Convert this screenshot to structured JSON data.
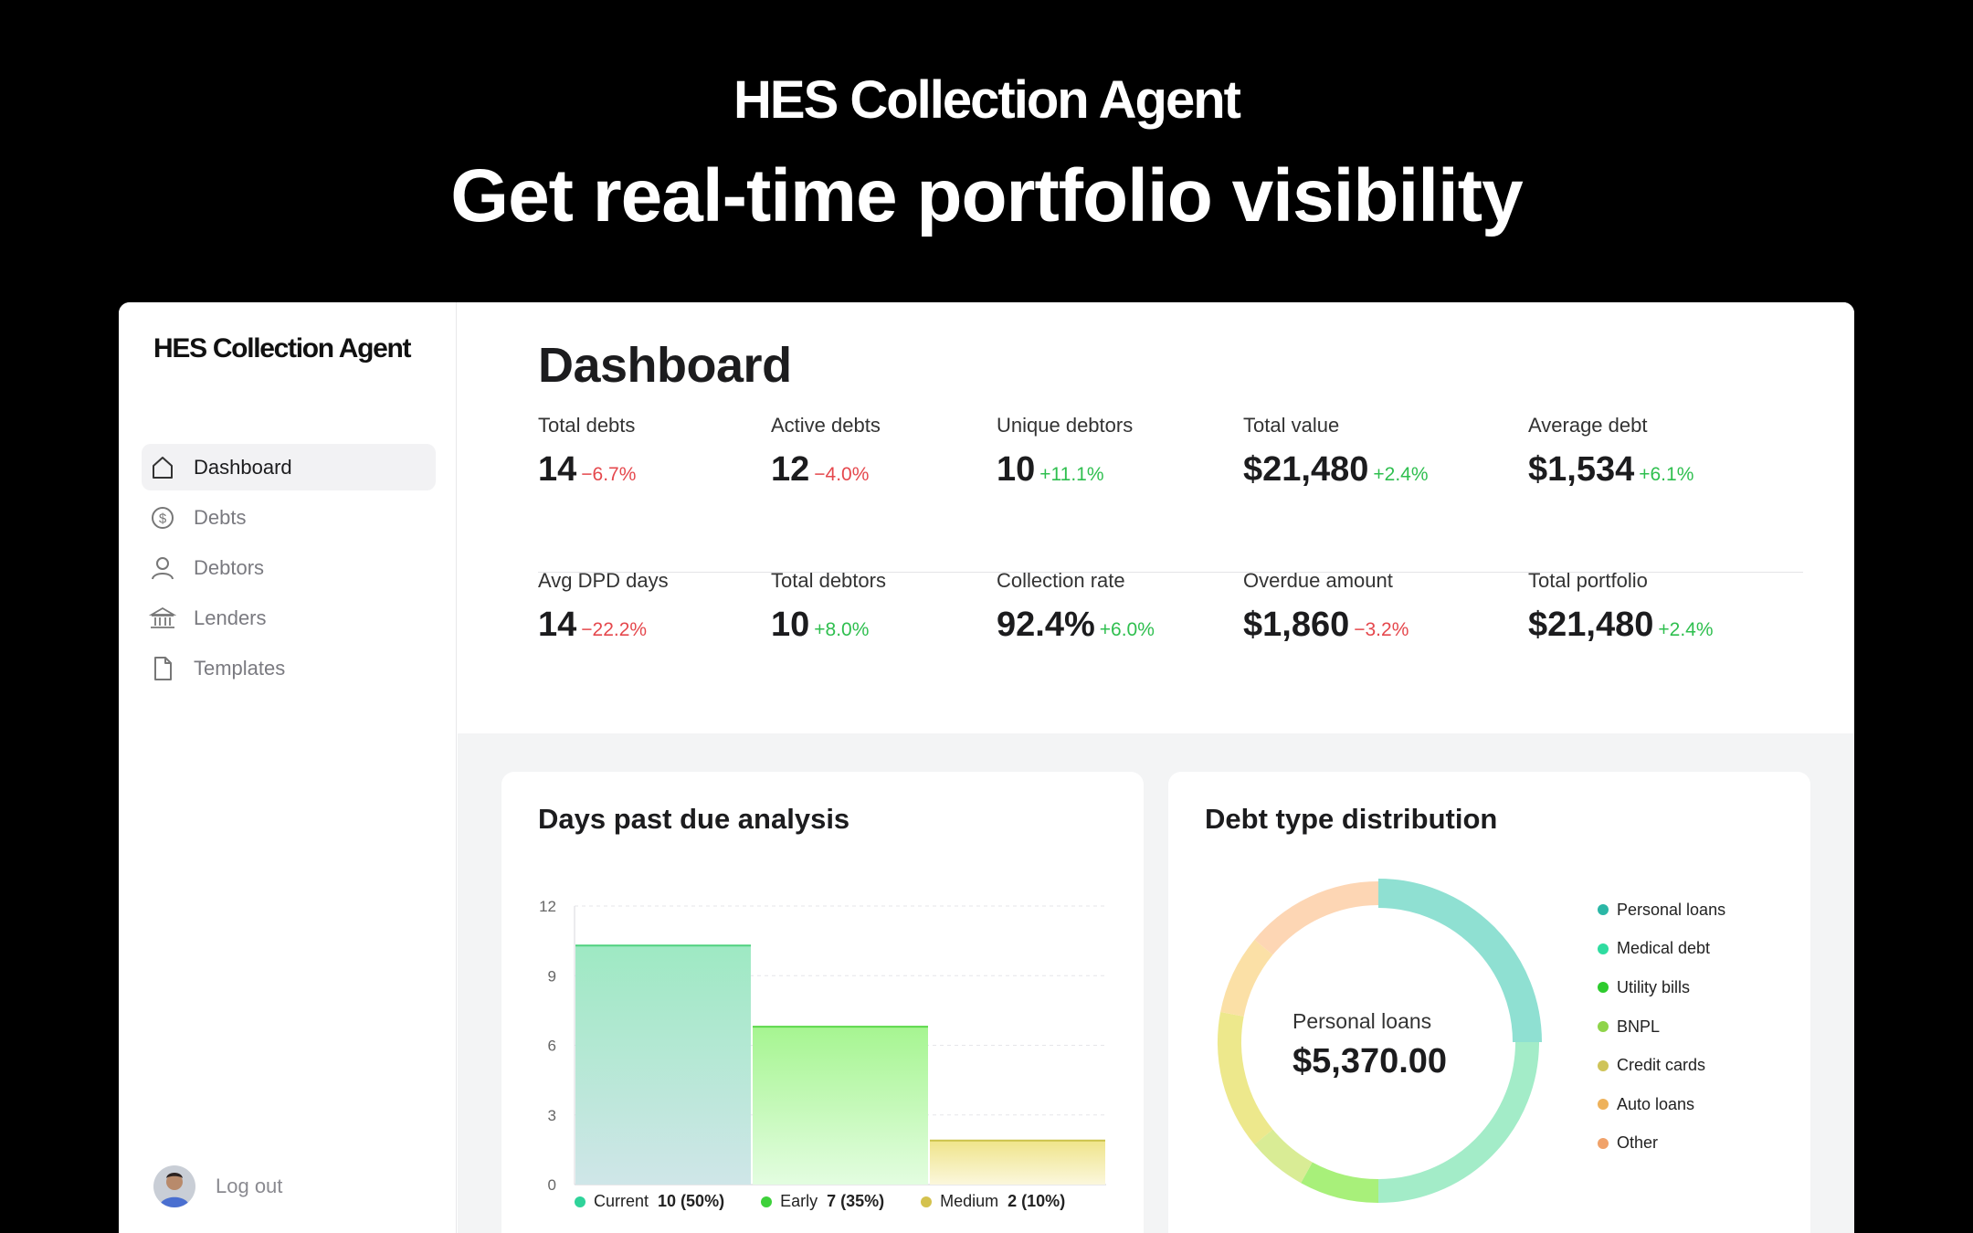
{
  "hero": {
    "brand": "HES Collection Agent",
    "title": "Get real-time portfolio visibility"
  },
  "sidebar": {
    "brand": "HES Collection Agent",
    "items": [
      {
        "label": "Dashboard",
        "icon": "home-icon",
        "active": true
      },
      {
        "label": "Debts",
        "icon": "dollar-circle-icon",
        "active": false
      },
      {
        "label": "Debtors",
        "icon": "user-icon",
        "active": false
      },
      {
        "label": "Lenders",
        "icon": "bank-icon",
        "active": false
      },
      {
        "label": "Templates",
        "icon": "document-icon",
        "active": false
      }
    ],
    "logout_label": "Log out"
  },
  "main": {
    "title": "Dashboard",
    "stats": [
      {
        "label": "Total debts",
        "value": "14",
        "delta": "−6.7%",
        "trend": "down"
      },
      {
        "label": "Active debts",
        "value": "12",
        "delta": "−4.0%",
        "trend": "down"
      },
      {
        "label": "Unique debtors",
        "value": "10",
        "delta": "+11.1%",
        "trend": "up"
      },
      {
        "label": "Total value",
        "value": "$21,480",
        "delta": "+2.4%",
        "trend": "up"
      },
      {
        "label": "Average debt",
        "value": "$1,534",
        "delta": "+6.1%",
        "trend": "up"
      },
      {
        "label": "Avg DPD days",
        "value": "14",
        "delta": "−22.2%",
        "trend": "down"
      },
      {
        "label": "Total debtors",
        "value": "10",
        "delta": "+8.0%",
        "trend": "up"
      },
      {
        "label": "Collection rate",
        "value": "92.4%",
        "delta": "+6.0%",
        "trend": "up"
      },
      {
        "label": "Overdue amount",
        "value": "$1,860",
        "delta": "−3.2%",
        "trend": "down"
      },
      {
        "label": "Total portfolio",
        "value": "$21,480",
        "delta": "+2.4%",
        "trend": "up"
      }
    ]
  },
  "dpd_card": {
    "title": "Days past due analysis",
    "legend": [
      {
        "name": "Current",
        "value": "10 (50%)",
        "color": "#2fd39a"
      },
      {
        "name": "Early",
        "value": "7 (35%)",
        "color": "#3ed13b"
      },
      {
        "name": "Medium",
        "value": "2 (10%)",
        "color": "#d4c24e"
      }
    ]
  },
  "debt_card": {
    "title": "Debt type distribution",
    "center_label": "Personal loans",
    "center_value": "$5,370.00",
    "legend": [
      {
        "name": "Personal loans",
        "color": "#2bb7a6"
      },
      {
        "name": "Medical debt",
        "color": "#2fdca0"
      },
      {
        "name": "Utility bills",
        "color": "#2ecb2e"
      },
      {
        "name": "BNPL",
        "color": "#8fd44a"
      },
      {
        "name": "Credit cards",
        "color": "#cfc459"
      },
      {
        "name": "Auto loans",
        "color": "#eeb25b"
      },
      {
        "name": "Other",
        "color": "#f0a26a"
      }
    ]
  },
  "chart_data": [
    {
      "type": "bar",
      "title": "Days past due analysis",
      "categories": [
        "Current",
        "Early",
        "Medium"
      ],
      "values": [
        10.3,
        6.8,
        1.9
      ],
      "yticks": [
        0,
        3,
        6,
        9,
        12
      ],
      "ylim": [
        0,
        12
      ],
      "grid": true,
      "colors": [
        "#8fe6bd",
        "#9df38b",
        "#ede88c"
      ]
    },
    {
      "type": "pie",
      "title": "Debt type distribution",
      "categories": [
        "Personal loans",
        "Medical debt",
        "Utility bills",
        "BNPL",
        "Credit cards",
        "Auto loans",
        "Other"
      ],
      "values": [
        25,
        25,
        8,
        6,
        14,
        8,
        14
      ],
      "colors": [
        "#8fe0d2",
        "#a3ecc8",
        "#a8f07a",
        "#d9ec95",
        "#ede88c",
        "#fbe0a6",
        "#fdd6b4"
      ],
      "highlighted": "Personal loans"
    }
  ]
}
